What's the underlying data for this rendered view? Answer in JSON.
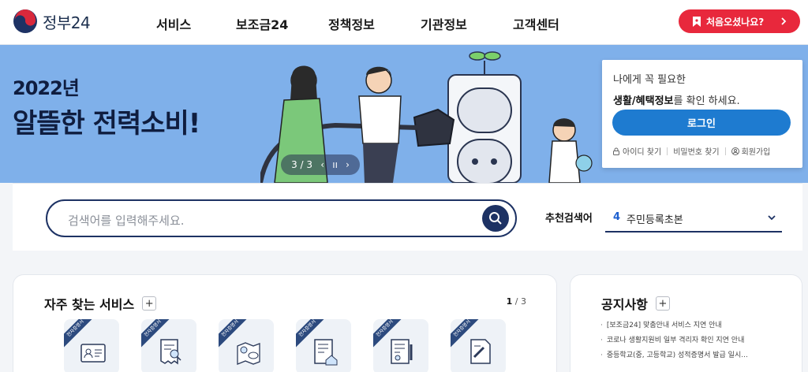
{
  "header": {
    "logo_text": "정부24",
    "nav": [
      "서비스",
      "보조금24",
      "정책정보",
      "기관정보",
      "고객센터"
    ],
    "first_visit_button": "처음오셨나요?"
  },
  "banner": {
    "year": "2022년",
    "title": "알뜰한 전력소비!",
    "slide_indicator": "3 / 3"
  },
  "login": {
    "message_line1": "나에게 꼭 필요한",
    "message_line2_bold": "생활/혜택정보",
    "message_line2_rest": "를 확인 하세요.",
    "login_button": "로그인",
    "links": [
      "아이디 찾기",
      "비밀번호 찾기",
      "회원가입"
    ]
  },
  "search": {
    "placeholder": "검색어를 입력해주세요.",
    "recommend_label": "추천검색어",
    "recommend_rank": "4",
    "recommend_term": "주민등록초본"
  },
  "services": {
    "title": "자주 찾는 서비스",
    "plus": "+",
    "page_current": "1",
    "page_total": "/ 3",
    "tile_badge": "전자증명서"
  },
  "notice": {
    "title": "공지사항",
    "plus": "+",
    "items": [
      "[보조금24] 맞춤안내 서비스 지연 안내",
      "코로나 생활지원비 일부 격리자 확인 지연 안내",
      "중등학교(중, 고등학교) 성적증명서 발급 일시..."
    ]
  },
  "colors": {
    "brand_navy": "#1d3264",
    "accent_red": "#e8283c",
    "login_blue": "#1e7bd0",
    "banner_bg": "#7fb0ea"
  }
}
